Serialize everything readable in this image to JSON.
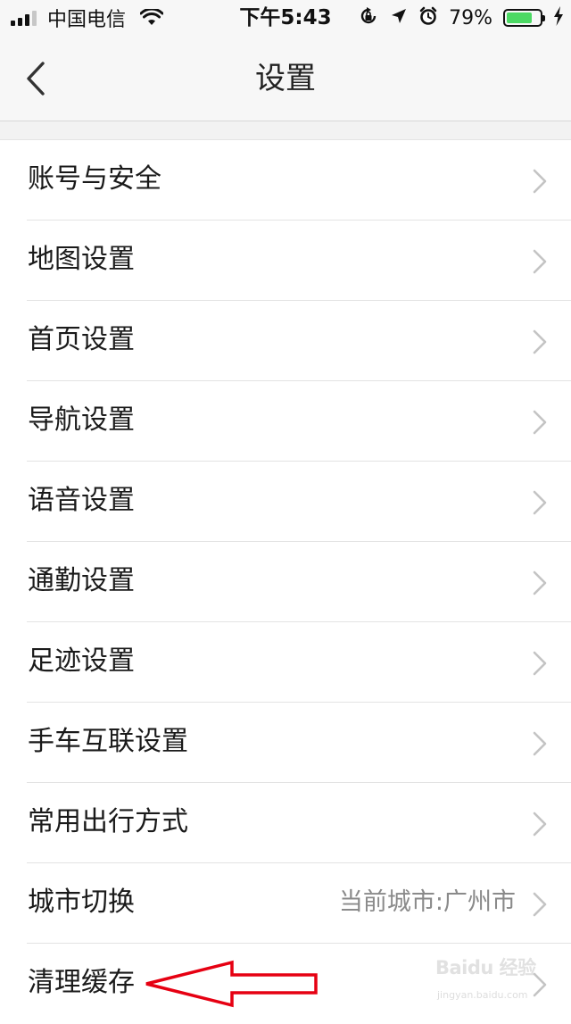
{
  "status_bar": {
    "carrier": "中国电信",
    "time": "下午5:43",
    "battery_percent": "79%",
    "battery_level": 0.79,
    "icons": [
      "signal-icon",
      "wifi-icon",
      "orientation-lock-icon",
      "location-arrow-icon",
      "alarm-icon",
      "battery-icon",
      "charging-bolt-icon"
    ]
  },
  "nav": {
    "title": "设置",
    "back_icon": "chevron-left-icon"
  },
  "settings": {
    "items": [
      {
        "label": "账号与安全",
        "value": ""
      },
      {
        "label": "地图设置",
        "value": ""
      },
      {
        "label": "首页设置",
        "value": ""
      },
      {
        "label": "导航设置",
        "value": ""
      },
      {
        "label": "语音设置",
        "value": ""
      },
      {
        "label": "通勤设置",
        "value": ""
      },
      {
        "label": "足迹设置",
        "value": ""
      },
      {
        "label": "手车互联设置",
        "value": ""
      },
      {
        "label": "常用出行方式",
        "value": ""
      },
      {
        "label": "城市切换",
        "value": "当前城市:广州市"
      },
      {
        "label": "清理缓存",
        "value": ""
      }
    ]
  },
  "annotation": {
    "arrow_color": "#e60012",
    "watermark_brand": "Baidu 经验",
    "watermark_url": "jingyan.baidu.com"
  },
  "colors": {
    "background": "#f2f2f2",
    "bar_background": "#f7f7f7",
    "list_background": "#ffffff",
    "divider": "#e3e3e3",
    "value_text": "#8a8a8a",
    "chevron": "#c4c4c4",
    "battery_fill": "#4cd964"
  }
}
